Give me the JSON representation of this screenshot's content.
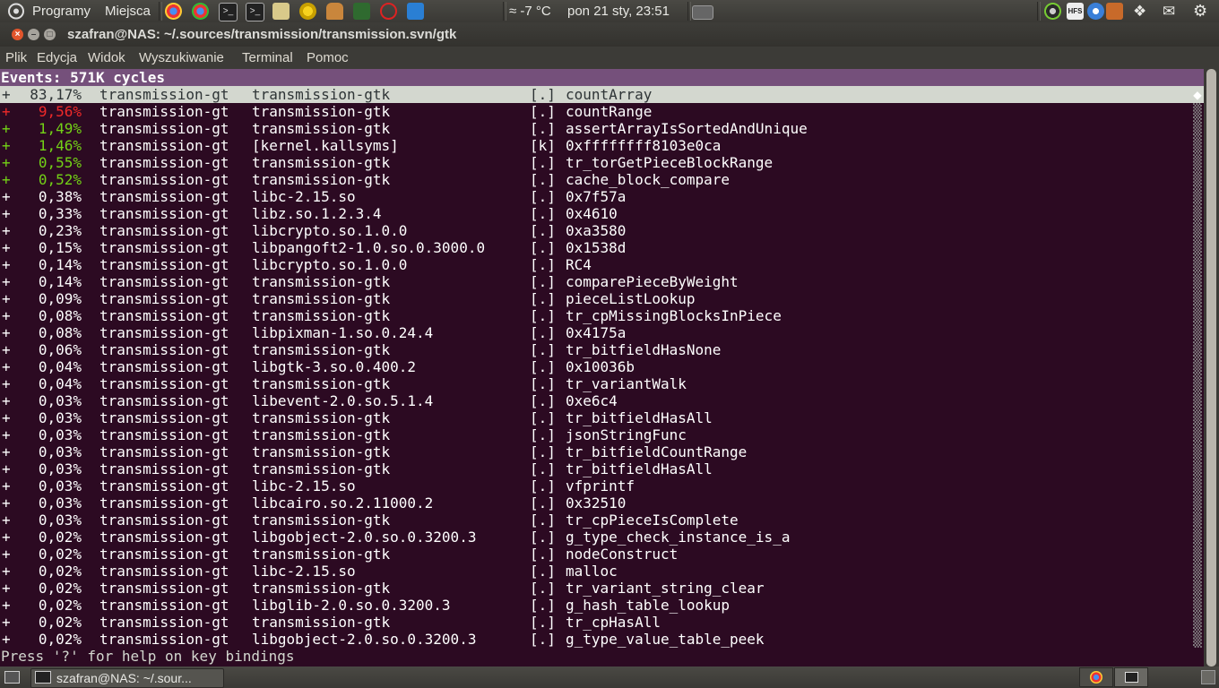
{
  "top_panel": {
    "apps_menu": "Programy",
    "places_menu": "Miejsca",
    "weather": "≈ -7 °C",
    "clock": "pon 21 sty, 23:51",
    "hfs_label": "HFS"
  },
  "window": {
    "title": "szafran@NAS: ~/.sources/transmission/transmission.svn/gtk"
  },
  "menu": [
    "Plik",
    "Edycja",
    "Widok",
    "Wyszukiwanie",
    "Terminal",
    "Pomoc"
  ],
  "perf": {
    "header": "Events: 571K cycles",
    "status": "Press '?' for help on key bindings",
    "rows": [
      {
        "sign": "+",
        "pct": "83,17%",
        "cmd": "transmission-gt",
        "dso": "transmission-gtk",
        "type": "[.]",
        "sym": "countArray",
        "color": "white",
        "selected": true
      },
      {
        "sign": "+",
        "pct": "9,56%",
        "cmd": "transmission-gt",
        "dso": "transmission-gtk",
        "type": "[.]",
        "sym": "countRange",
        "color": "red"
      },
      {
        "sign": "+",
        "pct": "1,49%",
        "cmd": "transmission-gt",
        "dso": "transmission-gtk",
        "type": "[.]",
        "sym": "assertArrayIsSortedAndUnique",
        "color": "green"
      },
      {
        "sign": "+",
        "pct": "1,46%",
        "cmd": "transmission-gt",
        "dso": "[kernel.kallsyms]",
        "type": "[k]",
        "sym": "0xffffffff8103e0ca",
        "color": "green"
      },
      {
        "sign": "+",
        "pct": "0,55%",
        "cmd": "transmission-gt",
        "dso": "transmission-gtk",
        "type": "[.]",
        "sym": "tr_torGetPieceBlockRange",
        "color": "green"
      },
      {
        "sign": "+",
        "pct": "0,52%",
        "cmd": "transmission-gt",
        "dso": "transmission-gtk",
        "type": "[.]",
        "sym": "cache_block_compare",
        "color": "green"
      },
      {
        "sign": "+",
        "pct": "0,38%",
        "cmd": "transmission-gt",
        "dso": "libc-2.15.so",
        "type": "[.]",
        "sym": "0x7f57a",
        "color": "white"
      },
      {
        "sign": "+",
        "pct": "0,33%",
        "cmd": "transmission-gt",
        "dso": "libz.so.1.2.3.4",
        "type": "[.]",
        "sym": "0x4610",
        "color": "white"
      },
      {
        "sign": "+",
        "pct": "0,23%",
        "cmd": "transmission-gt",
        "dso": "libcrypto.so.1.0.0",
        "type": "[.]",
        "sym": "0xa3580",
        "color": "white"
      },
      {
        "sign": "+",
        "pct": "0,15%",
        "cmd": "transmission-gt",
        "dso": "libpangoft2-1.0.so.0.3000.0",
        "type": "[.]",
        "sym": "0x1538d",
        "color": "white"
      },
      {
        "sign": "+",
        "pct": "0,14%",
        "cmd": "transmission-gt",
        "dso": "libcrypto.so.1.0.0",
        "type": "[.]",
        "sym": "RC4",
        "color": "white"
      },
      {
        "sign": "+",
        "pct": "0,14%",
        "cmd": "transmission-gt",
        "dso": "transmission-gtk",
        "type": "[.]",
        "sym": "comparePieceByWeight",
        "color": "white"
      },
      {
        "sign": "+",
        "pct": "0,09%",
        "cmd": "transmission-gt",
        "dso": "transmission-gtk",
        "type": "[.]",
        "sym": "pieceListLookup",
        "color": "white"
      },
      {
        "sign": "+",
        "pct": "0,08%",
        "cmd": "transmission-gt",
        "dso": "transmission-gtk",
        "type": "[.]",
        "sym": "tr_cpMissingBlocksInPiece",
        "color": "white"
      },
      {
        "sign": "+",
        "pct": "0,08%",
        "cmd": "transmission-gt",
        "dso": "libpixman-1.so.0.24.4",
        "type": "[.]",
        "sym": "0x4175a",
        "color": "white"
      },
      {
        "sign": "+",
        "pct": "0,06%",
        "cmd": "transmission-gt",
        "dso": "transmission-gtk",
        "type": "[.]",
        "sym": "tr_bitfieldHasNone",
        "color": "white"
      },
      {
        "sign": "+",
        "pct": "0,04%",
        "cmd": "transmission-gt",
        "dso": "libgtk-3.so.0.400.2",
        "type": "[.]",
        "sym": "0x10036b",
        "color": "white"
      },
      {
        "sign": "+",
        "pct": "0,04%",
        "cmd": "transmission-gt",
        "dso": "transmission-gtk",
        "type": "[.]",
        "sym": "tr_variantWalk",
        "color": "white"
      },
      {
        "sign": "+",
        "pct": "0,03%",
        "cmd": "transmission-gt",
        "dso": "libevent-2.0.so.5.1.4",
        "type": "[.]",
        "sym": "0xe6c4",
        "color": "white"
      },
      {
        "sign": "+",
        "pct": "0,03%",
        "cmd": "transmission-gt",
        "dso": "transmission-gtk",
        "type": "[.]",
        "sym": "tr_bitfieldHasAll",
        "color": "white"
      },
      {
        "sign": "+",
        "pct": "0,03%",
        "cmd": "transmission-gt",
        "dso": "transmission-gtk",
        "type": "[.]",
        "sym": "jsonStringFunc",
        "color": "white"
      },
      {
        "sign": "+",
        "pct": "0,03%",
        "cmd": "transmission-gt",
        "dso": "transmission-gtk",
        "type": "[.]",
        "sym": "tr_bitfieldCountRange",
        "color": "white"
      },
      {
        "sign": "+",
        "pct": "0,03%",
        "cmd": "transmission-gt",
        "dso": "transmission-gtk",
        "type": "[.]",
        "sym": "tr_bitfieldHasAll",
        "color": "white"
      },
      {
        "sign": "+",
        "pct": "0,03%",
        "cmd": "transmission-gt",
        "dso": "libc-2.15.so",
        "type": "[.]",
        "sym": "vfprintf",
        "color": "white"
      },
      {
        "sign": "+",
        "pct": "0,03%",
        "cmd": "transmission-gt",
        "dso": "libcairo.so.2.11000.2",
        "type": "[.]",
        "sym": "0x32510",
        "color": "white"
      },
      {
        "sign": "+",
        "pct": "0,03%",
        "cmd": "transmission-gt",
        "dso": "transmission-gtk",
        "type": "[.]",
        "sym": "tr_cpPieceIsComplete",
        "color": "white"
      },
      {
        "sign": "+",
        "pct": "0,02%",
        "cmd": "transmission-gt",
        "dso": "libgobject-2.0.so.0.3200.3",
        "type": "[.]",
        "sym": "g_type_check_instance_is_a",
        "color": "white"
      },
      {
        "sign": "+",
        "pct": "0,02%",
        "cmd": "transmission-gt",
        "dso": "transmission-gtk",
        "type": "[.]",
        "sym": "nodeConstruct",
        "color": "white"
      },
      {
        "sign": "+",
        "pct": "0,02%",
        "cmd": "transmission-gt",
        "dso": "libc-2.15.so",
        "type": "[.]",
        "sym": "malloc",
        "color": "white"
      },
      {
        "sign": "+",
        "pct": "0,02%",
        "cmd": "transmission-gt",
        "dso": "transmission-gtk",
        "type": "[.]",
        "sym": "tr_variant_string_clear",
        "color": "white"
      },
      {
        "sign": "+",
        "pct": "0,02%",
        "cmd": "transmission-gt",
        "dso": "libglib-2.0.so.0.3200.3",
        "type": "[.]",
        "sym": "g_hash_table_lookup",
        "color": "white"
      },
      {
        "sign": "+",
        "pct": "0,02%",
        "cmd": "transmission-gt",
        "dso": "transmission-gtk",
        "type": "[.]",
        "sym": "tr_cpHasAll",
        "color": "white"
      },
      {
        "sign": "+",
        "pct": "0,02%",
        "cmd": "transmission-gt",
        "dso": "libgobject-2.0.so.0.3200.3",
        "type": "[.]",
        "sym": "g_type_value_table_peek",
        "color": "white"
      }
    ]
  },
  "taskbar": {
    "window_button": "szafran@NAS: ~/.sour..."
  }
}
